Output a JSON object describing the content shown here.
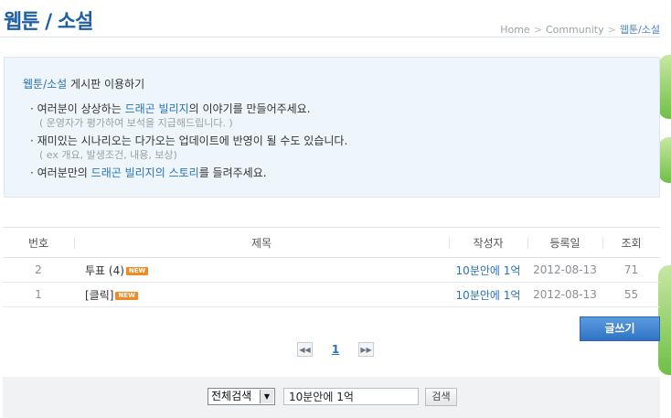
{
  "header": {
    "title": "웹툰 / 소설",
    "breadcrumb": [
      "Home",
      "Community",
      "웹툰/소설"
    ]
  },
  "info": {
    "title_highlight": "웹툰/소설",
    "title_rest": " 게시판 이용하기",
    "line1": {
      "pre": "· 여러분이 상상하는 ",
      "hl": "드래곤 빌리지",
      "post": "의 이야기를 만들어주세요."
    },
    "line1_sub": "( 운영자가 평가하여 보석을 지급해드립니다. )",
    "line2": "· 재미있는 시나리오는 다가오는 업데이트에 반영이 될 수도 있습니다.",
    "line2_sub": "( ex 개요, 발생조건, 내용, 보상)",
    "line3": {
      "pre": "· 여러분만의 ",
      "hl": "드래곤 빌리지의 스토리",
      "post": "를 들려주세요."
    }
  },
  "table": {
    "headers": {
      "no": "번호",
      "subject": "제목",
      "writer": "작성자",
      "date": "등록일",
      "views": "조회"
    },
    "rows": [
      {
        "no": "2",
        "subject": "투표 (4)",
        "badge": "NEW",
        "writer": "10분안에 1억",
        "date": "2012-08-13",
        "views": "71"
      },
      {
        "no": "1",
        "subject": "[클릭]",
        "badge": "NEW",
        "writer": "10분안에 1억",
        "date": "2012-08-13",
        "views": "55"
      }
    ]
  },
  "write_button": "글쓰기",
  "pagination": {
    "current": "1",
    "prev_icon": "double-left-arrow",
    "next_icon": "double-right-arrow"
  },
  "search": {
    "scope": "전체검색",
    "query": "10분안에 1억",
    "button": "검색"
  }
}
